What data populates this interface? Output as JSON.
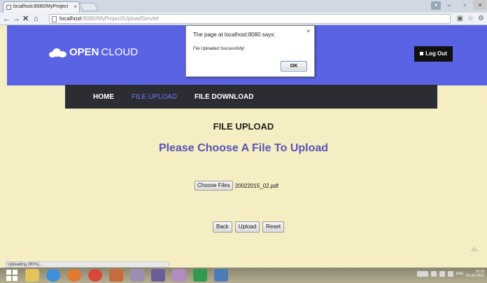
{
  "browser": {
    "tab_title": "localhost:8080/MyProject ×",
    "tab_label": "localhost:8080/MyProject",
    "url_host": "localhost",
    "url_rest": ":8080/MyProject/UploadServlet"
  },
  "header": {
    "brand_bold": "OPEN",
    "brand_rest": "CLOUD",
    "logout_label": "Log Out"
  },
  "nav": {
    "home": "HOME",
    "file_upload": "FILE UPLOAD",
    "file_download": "FILE DOWNLOAD"
  },
  "main": {
    "heading": "FILE UPLOAD",
    "subheading": "Please Choose A File To Upload",
    "choose_files_label": "Choose Files",
    "selected_file": "20022015_02.pdf",
    "back_label": "Back",
    "upload_label": "Upload",
    "reset_label": "Reset"
  },
  "dialog": {
    "title": "The page at localhost:8080 says:",
    "message": "File Uploaded Successfully!",
    "ok_label": "OK",
    "close": "×"
  },
  "status": {
    "text": "Uploading (90%)..."
  },
  "taskbar": {
    "lang": "ENG",
    "time": "16:19",
    "date": "01-03-2015"
  },
  "colors": {
    "header_bg": "#5a63e4",
    "nav_bg": "#2c2d33",
    "page_bg": "#f5eec2",
    "accent": "#5a53b8"
  }
}
